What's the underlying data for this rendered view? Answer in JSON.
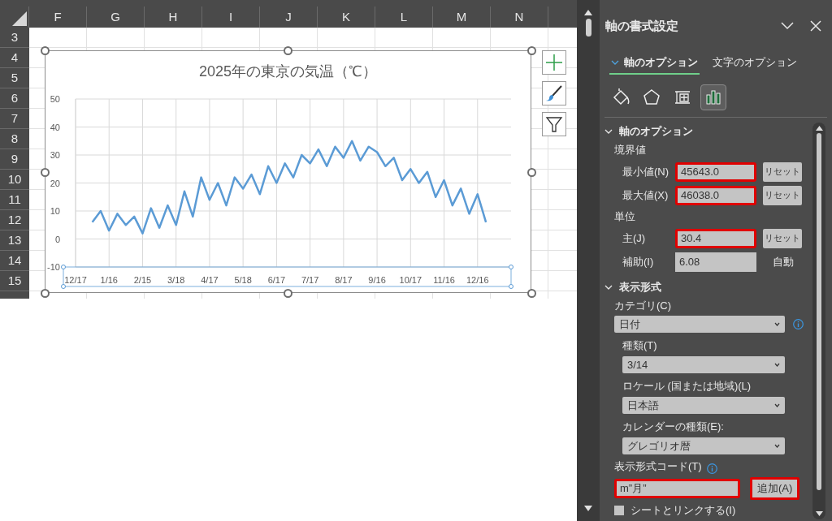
{
  "sheet": {
    "columns": [
      "F",
      "G",
      "H",
      "I",
      "J",
      "K",
      "L",
      "M",
      "N"
    ],
    "rows": [
      "3",
      "4",
      "5",
      "6",
      "7",
      "8",
      "9",
      "10",
      "11",
      "12",
      "13",
      "14",
      "15"
    ]
  },
  "chart": {
    "selected": true,
    "axis_selected": true,
    "chart_data": {
      "type": "line",
      "grid": true,
      "title": "2025年の東京の気温（℃）",
      "ylim": [
        -10,
        50
      ],
      "yticks": [
        -10,
        0,
        10,
        20,
        30,
        40,
        50
      ],
      "categories": [
        "12/17",
        null,
        null,
        null,
        "1/16",
        null,
        null,
        null,
        "2/15",
        null,
        null,
        null,
        "3/18",
        null,
        null,
        null,
        "4/17",
        null,
        null,
        null,
        "5/18",
        null,
        null,
        null,
        "6/17",
        null,
        null,
        null,
        "7/17",
        null,
        null,
        null,
        "8/17",
        null,
        null,
        null,
        "9/16",
        null,
        null,
        null,
        "10/17",
        null,
        null,
        null,
        "11/16",
        null,
        null,
        null,
        "12/16",
        null,
        null,
        null,
        null
      ],
      "series": [
        {
          "color": "#5b9bd5",
          "values": [
            null,
            null,
            6,
            10,
            3,
            9,
            5,
            8,
            2,
            11,
            4,
            12,
            5,
            17,
            8,
            22,
            14,
            20,
            12,
            22,
            18,
            23,
            16,
            26,
            20,
            27,
            22,
            30,
            27,
            32,
            26,
            33,
            29,
            35,
            28,
            33,
            31,
            26,
            29,
            21,
            25,
            20,
            24,
            15,
            21,
            12,
            18,
            9,
            16,
            6,
            null,
            null,
            null
          ]
        }
      ]
    }
  },
  "panel": {
    "title": "軸の書式設定",
    "tabs": [
      {
        "label": "軸のオプション",
        "selected": true
      },
      {
        "label": "文字のオプション",
        "selected": false
      }
    ],
    "icon_tabs": [
      {
        "kind": "fill",
        "selected": false
      },
      {
        "kind": "effects",
        "selected": false
      },
      {
        "kind": "size",
        "selected": false
      },
      {
        "kind": "axis",
        "selected": true
      }
    ],
    "axis_options": {
      "title": "軸のオプション",
      "expanded": true,
      "groups": [
        {
          "label": "境界値",
          "rows": [
            {
              "label": "最小値(N)",
              "value": "45643.0",
              "highlighted": true,
              "kind": "button",
              "action": "リセット"
            },
            {
              "label": "最大値(X)",
              "value": "46038.0",
              "highlighted": true,
              "kind": "button",
              "action": "リセット"
            }
          ]
        },
        {
          "label": "単位",
          "rows": [
            {
              "label": "主(J)",
              "value": "30.4",
              "highlighted": true,
              "kind": "button",
              "action": "リセット"
            },
            {
              "label": "補助(I)",
              "value": "6.08",
              "highlighted": false,
              "kind": "text",
              "action": "自動"
            }
          ]
        }
      ]
    },
    "number_format": {
      "title": "表示形式",
      "expanded": true,
      "category_label": "カテゴリ(C)",
      "category": "日付",
      "dropdowns": [
        {
          "label": "種類(T)",
          "value": "3/14"
        },
        {
          "label": "ロケール (国または地域)(L)",
          "value": "日本語"
        },
        {
          "label": "カレンダーの種類(E):",
          "value": "グレゴリオ暦"
        }
      ],
      "code_label": "表示形式コード(T)",
      "code": "m”月”",
      "code_highlighted": true,
      "add_button": "追加(A)",
      "add_highlighted": true,
      "link": {
        "label": "シートとリンクする(I)",
        "checked": false
      }
    }
  }
}
